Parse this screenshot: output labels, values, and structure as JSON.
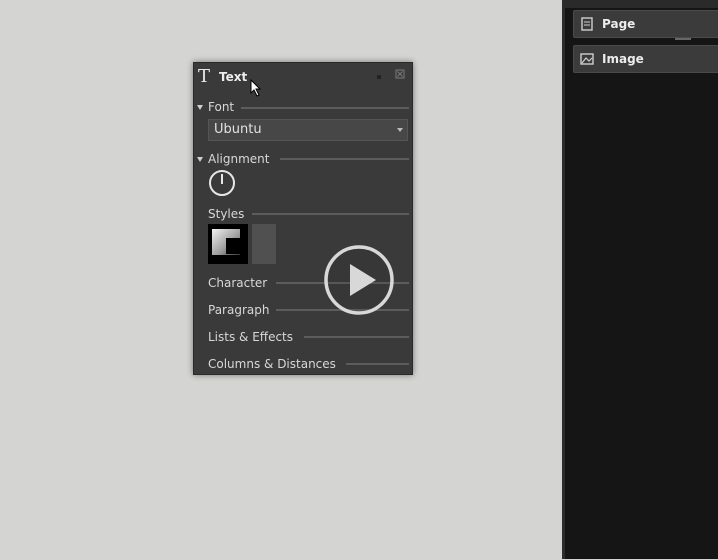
{
  "sidepanel": {
    "items": [
      {
        "label": "Page",
        "icon": "page-icon"
      },
      {
        "label": "Image",
        "icon": "image-icon"
      }
    ]
  },
  "dialog": {
    "title": "Text",
    "title_icon_glyph": "T",
    "sections": {
      "font": "Font",
      "alignment": "Alignment",
      "styles": "Styles",
      "character": "Character",
      "paragraph": "Paragraph",
      "lists_effects": "Lists & Effects",
      "columns_distances": "Columns & Distances"
    },
    "font_dropdown": {
      "value": "Ubuntu"
    }
  },
  "colors": {
    "canvas_bg": "#d4d4d2",
    "dialog_bg": "#3a3a3a",
    "sidepanel_bg": "#151515",
    "text": "#dadada"
  }
}
